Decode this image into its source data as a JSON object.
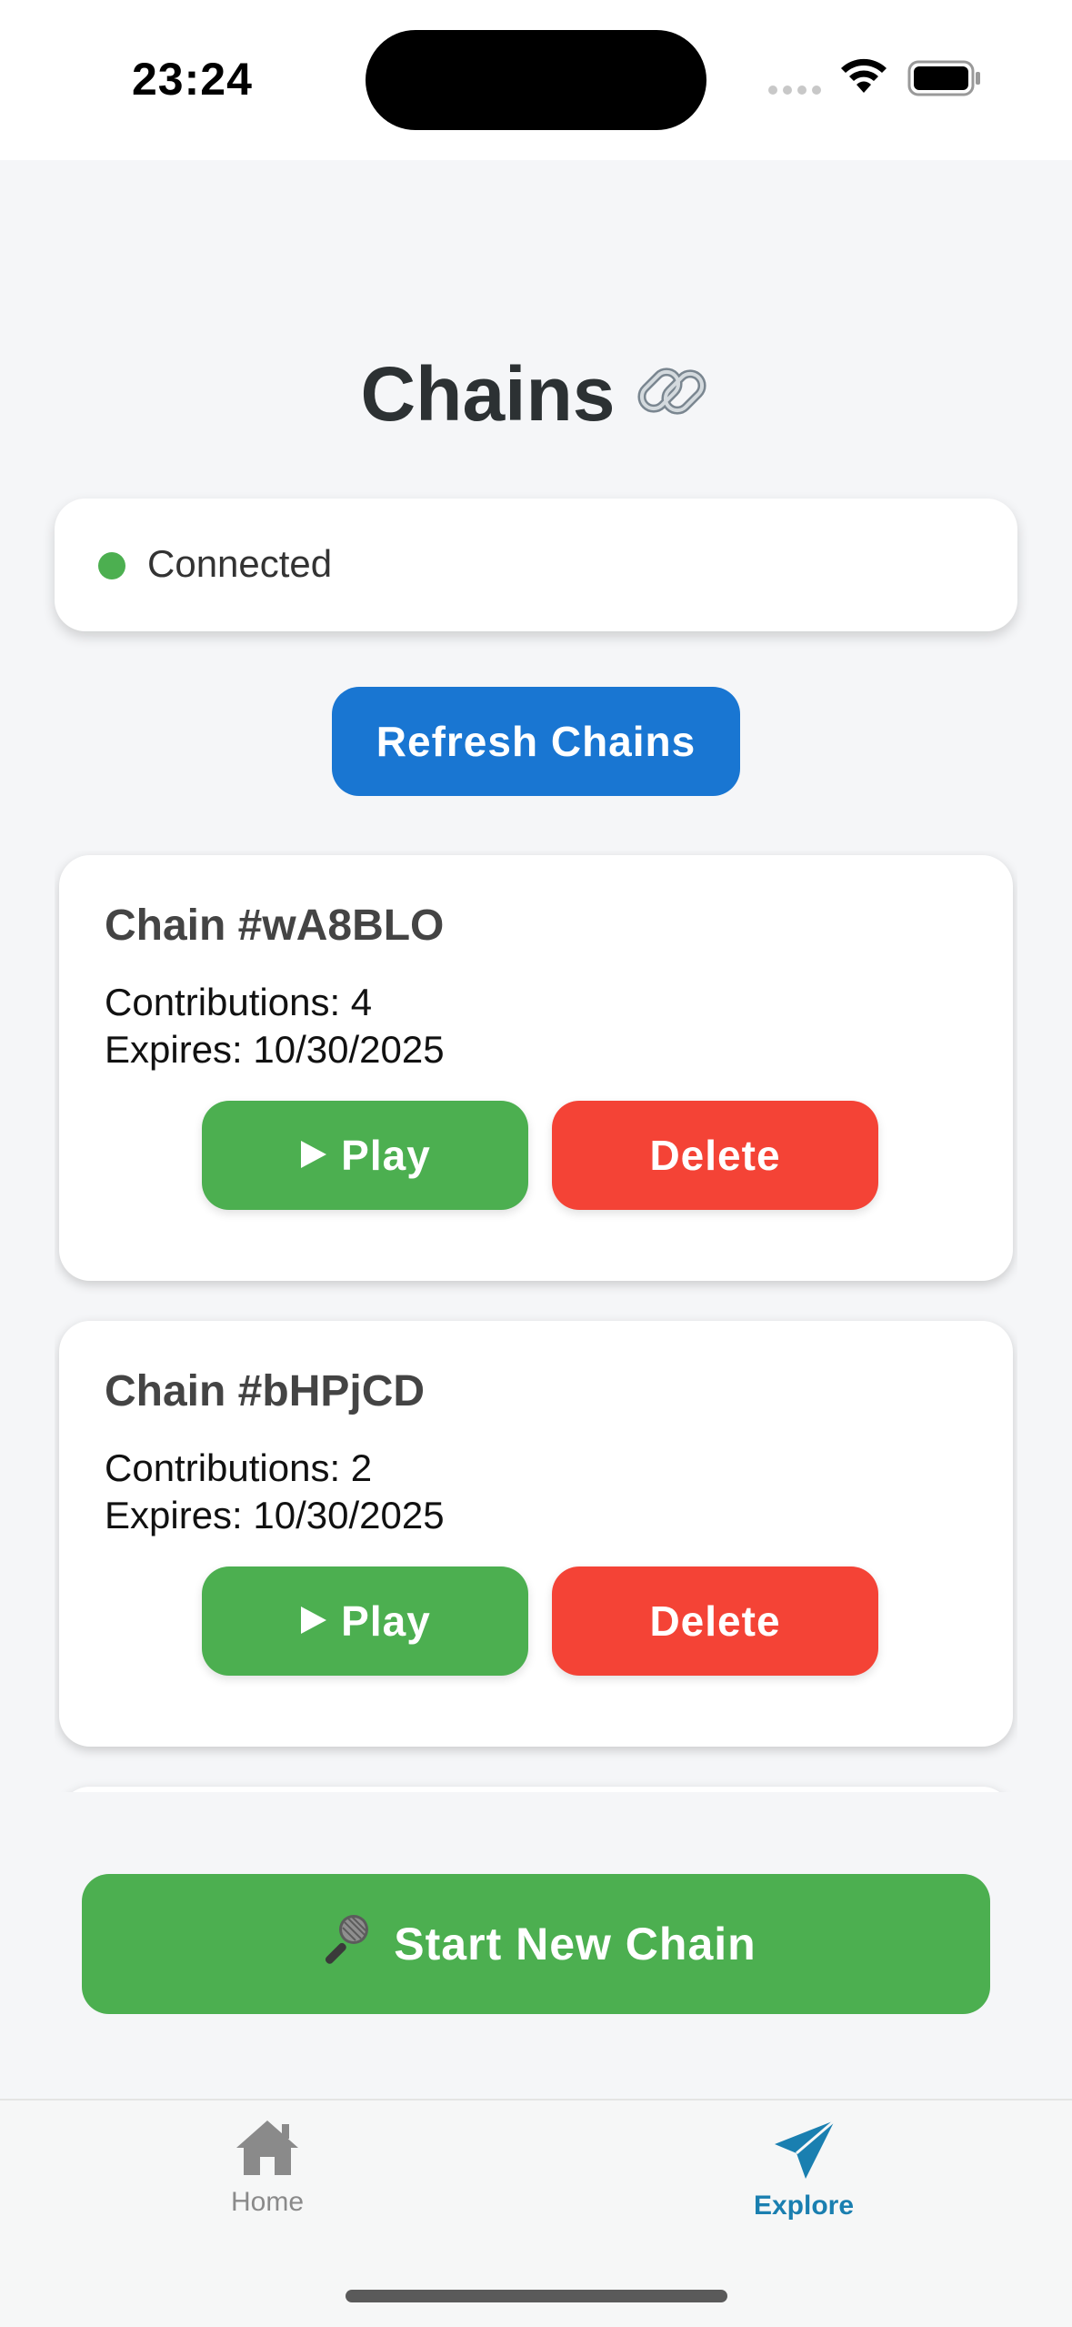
{
  "status_bar": {
    "time": "23:24"
  },
  "page": {
    "title": "Chains",
    "title_icon": "link-icon"
  },
  "connection": {
    "label": "Connected",
    "status_color": "#4caf50"
  },
  "refresh_button": {
    "label": "Refresh Chains"
  },
  "chains": [
    {
      "title": "Chain #wA8BLO",
      "contributions": "Contributions: 4",
      "expires": "Expires: 10/30/2025",
      "play_label": "Play",
      "delete_label": "Delete"
    },
    {
      "title": "Chain #bHPjCD",
      "contributions": "Contributions: 2",
      "expires": "Expires: 10/30/2025",
      "play_label": "Play",
      "delete_label": "Delete"
    }
  ],
  "start_button": {
    "label": "Start New Chain",
    "icon": "microphone-icon"
  },
  "tab_bar": {
    "tabs": [
      {
        "label": "Home",
        "icon": "home-icon",
        "active": false
      },
      {
        "label": "Explore",
        "icon": "paper-plane-icon",
        "active": true
      }
    ]
  },
  "colors": {
    "primary_blue": "#1976d2",
    "green": "#4caf50",
    "red": "#f44336",
    "active_tab": "#1a7fb0"
  }
}
